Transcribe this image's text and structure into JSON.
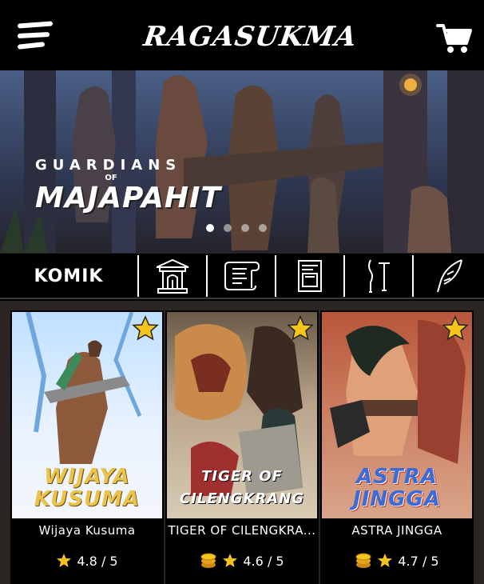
{
  "header": {
    "logo_text": "RAGASUKMA",
    "menu_icon": "hamburger-menu-icon",
    "cart_icon": "shopping-cart-icon"
  },
  "banner": {
    "title_top": "GUARDIANS",
    "title_of": "OF",
    "title_main": "MAJAPAHIT",
    "slides": 4,
    "active_slide": 1
  },
  "tabs": {
    "active_label": "KOMIK",
    "icons": [
      "temple-icon",
      "scroll-icon",
      "document-icon",
      "weapons-icon",
      "feather-quill-icon"
    ]
  },
  "cards": [
    {
      "title": "Wijaya Kusuma",
      "cover_text": "WIJAYA KUSUMA",
      "rating": "4.8 / 5",
      "has_coin": false,
      "accent": "#e9c34a"
    },
    {
      "title": "TIGER OF CILENGKRA...",
      "cover_text": "TIGER OF CILENGKRANG",
      "rating": "4.6 / 5",
      "has_coin": true,
      "accent": "#ffffff"
    },
    {
      "title": "ASTRA JINGGA",
      "cover_text": "ASTRA JINGGA",
      "rating": "4.7 / 5",
      "has_coin": true,
      "accent": "#3b6bd6"
    }
  ],
  "colors": {
    "star": "#f6c51d",
    "coin": "#e8a418",
    "grid_bg": "#2b2624"
  }
}
